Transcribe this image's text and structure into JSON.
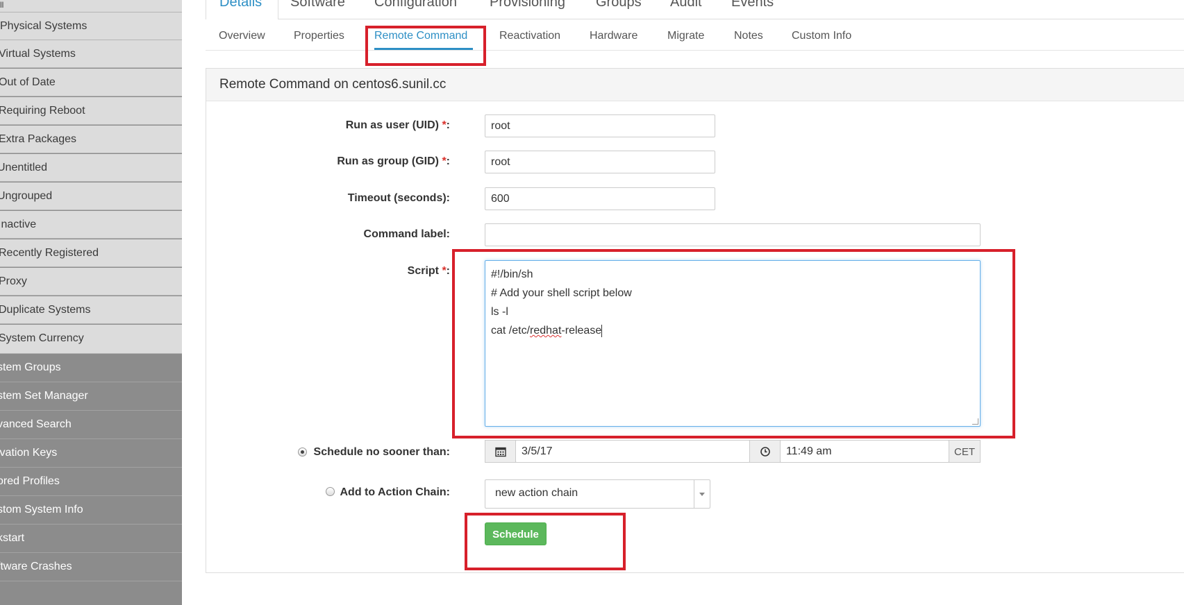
{
  "sidebar": {
    "top_item": "ll",
    "items": [
      {
        "label": "Physical Systems"
      },
      {
        "label": "Virtual Systems"
      },
      {
        "label": "Out of Date"
      },
      {
        "label": "Requiring Reboot"
      },
      {
        "label": "Extra Packages"
      },
      {
        "label": "Unentitled"
      },
      {
        "label": "Ungrouped"
      },
      {
        "label": "Inactive"
      },
      {
        "label": "Recently Registered"
      },
      {
        "label": "Proxy"
      },
      {
        "label": "Duplicate Systems"
      },
      {
        "label": "System Currency"
      }
    ],
    "sections": [
      {
        "label": "stem Groups"
      },
      {
        "label": "stem Set Manager"
      },
      {
        "label": "vanced Search"
      },
      {
        "label": "ivation Keys"
      },
      {
        "label": "ored Profiles"
      },
      {
        "label": "stom System Info"
      },
      {
        "label": "kstart"
      },
      {
        "label": "ftware Crashes"
      }
    ]
  },
  "main_tabs": [
    {
      "label": "Details"
    },
    {
      "label": "Software"
    },
    {
      "label": "Configuration"
    },
    {
      "label": "Provisioning"
    },
    {
      "label": "Groups"
    },
    {
      "label": "Audit"
    },
    {
      "label": "Events"
    }
  ],
  "sub_tabs": [
    {
      "label": "Overview"
    },
    {
      "label": "Properties"
    },
    {
      "label": "Remote Command"
    },
    {
      "label": "Reactivation"
    },
    {
      "label": "Hardware"
    },
    {
      "label": "Migrate"
    },
    {
      "label": "Notes"
    },
    {
      "label": "Custom Info"
    }
  ],
  "panel": {
    "title": "Remote Command on centos6.sunil.cc"
  },
  "form": {
    "uid_label": "Run as user (UID) ",
    "uid_value": "root",
    "gid_label": "Run as group (GID) ",
    "gid_value": "root",
    "timeout_label": "Timeout (seconds):",
    "timeout_value": "600",
    "command_label_label": "Command label:",
    "command_label_value": "",
    "script_label": "Script ",
    "required_mark": "*",
    "colon": ":",
    "script_lines": [
      "#!/bin/sh",
      "# Add your shell script below",
      "ls -l",
      "cat /etc/"
    ],
    "script_spell_word": "redhat",
    "script_tail": "-release",
    "schedule_label": "Schedule no sooner than:",
    "date_value": "3/5/17",
    "time_value": "11:49 am",
    "timezone": "CET",
    "action_chain_label": "Add to Action Chain:",
    "action_chain_value": "new action chain",
    "schedule_button": "Schedule"
  },
  "icons": {
    "calendar": "calendar-icon",
    "clock": "clock-icon"
  },
  "colors": {
    "accent": "#2d8fc5",
    "highlight": "#d7202b",
    "button": "#5cb85c"
  }
}
